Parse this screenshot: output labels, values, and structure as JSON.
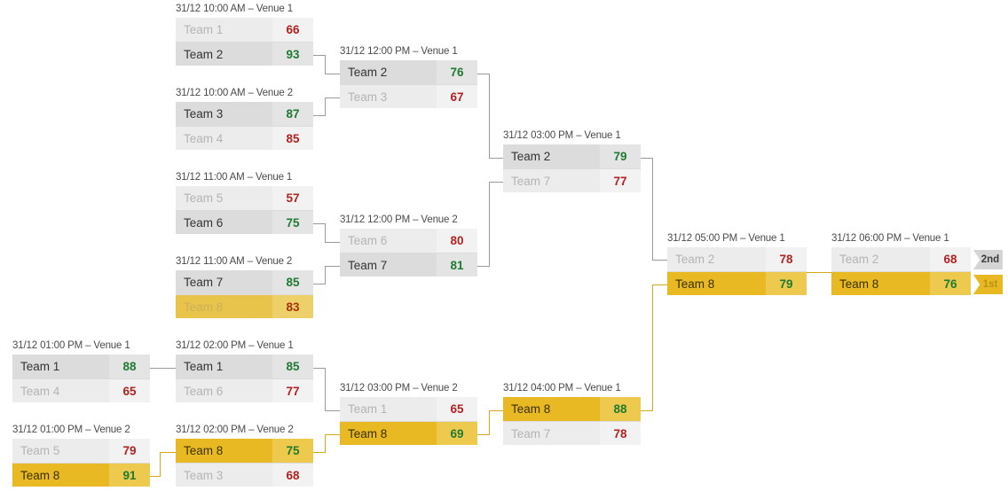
{
  "bracket": {
    "highlight_team": "Team 8",
    "colors": {
      "gold": "#e8b923",
      "gold_light": "#edca4e",
      "winner_bg": "#dcdcdc",
      "loser_bg": "#ececec",
      "win_score": "#1f7a32",
      "lose_score": "#b22222",
      "connector": "#9a9a9a",
      "connector_gold": "#d6a81e"
    },
    "badges": [
      {
        "key": "second",
        "label": "2nd"
      },
      {
        "key": "first",
        "label": "1st"
      }
    ],
    "matches": [
      {
        "id": "m1",
        "label": "31/12 10:00 AM – Venue 1",
        "top": {
          "name": "Team 1",
          "score": "66",
          "result": "lose",
          "gold": false
        },
        "bottom": {
          "name": "Team 2",
          "score": "93",
          "result": "win",
          "gold": false
        }
      },
      {
        "id": "m2",
        "label": "31/12 10:00 AM – Venue 2",
        "top": {
          "name": "Team 3",
          "score": "87",
          "result": "win",
          "gold": false
        },
        "bottom": {
          "name": "Team 4",
          "score": "85",
          "result": "lose",
          "gold": false
        }
      },
      {
        "id": "m3",
        "label": "31/12 11:00 AM – Venue 1",
        "top": {
          "name": "Team 5",
          "score": "57",
          "result": "lose",
          "gold": false
        },
        "bottom": {
          "name": "Team 6",
          "score": "75",
          "result": "win",
          "gold": false
        }
      },
      {
        "id": "m4",
        "label": "31/12 11:00 AM – Venue 2",
        "top": {
          "name": "Team 7",
          "score": "85",
          "result": "win",
          "gold": false
        },
        "bottom": {
          "name": "Team 8",
          "score": "83",
          "result": "lose",
          "gold": true
        }
      },
      {
        "id": "m5",
        "label": "31/12 12:00 PM – Venue 1",
        "top": {
          "name": "Team 2",
          "score": "76",
          "result": "win",
          "gold": false
        },
        "bottom": {
          "name": "Team 3",
          "score": "67",
          "result": "lose",
          "gold": false
        }
      },
      {
        "id": "m6",
        "label": "31/12 12:00 PM – Venue 2",
        "top": {
          "name": "Team 6",
          "score": "80",
          "result": "lose",
          "gold": false
        },
        "bottom": {
          "name": "Team 7",
          "score": "81",
          "result": "win",
          "gold": false
        }
      },
      {
        "id": "m7",
        "label": "31/12 03:00 PM – Venue 1",
        "top": {
          "name": "Team 2",
          "score": "79",
          "result": "win",
          "gold": false
        },
        "bottom": {
          "name": "Team 7",
          "score": "77",
          "result": "lose",
          "gold": false
        }
      },
      {
        "id": "m8",
        "label": "31/12 05:00 PM – Venue 1",
        "top": {
          "name": "Team 2",
          "score": "78",
          "result": "lose",
          "gold": false
        },
        "bottom": {
          "name": "Team 8",
          "score": "79",
          "result": "win",
          "gold": true
        }
      },
      {
        "id": "m9",
        "label": "31/12 06:00 PM – Venue 1",
        "top": {
          "name": "Team 2",
          "score": "68",
          "result": "lose",
          "gold": false
        },
        "bottom": {
          "name": "Team 8",
          "score": "76",
          "result": "win",
          "gold": true
        }
      },
      {
        "id": "m10",
        "label": "31/12 01:00 PM – Venue 1",
        "top": {
          "name": "Team 1",
          "score": "88",
          "result": "win",
          "gold": false
        },
        "bottom": {
          "name": "Team 4",
          "score": "65",
          "result": "lose",
          "gold": false
        }
      },
      {
        "id": "m11",
        "label": "31/12 01:00 PM – Venue 2",
        "top": {
          "name": "Team 5",
          "score": "79",
          "result": "lose",
          "gold": false
        },
        "bottom": {
          "name": "Team 8",
          "score": "91",
          "result": "win",
          "gold": true
        }
      },
      {
        "id": "m12",
        "label": "31/12 02:00 PM – Venue 1",
        "top": {
          "name": "Team 1",
          "score": "85",
          "result": "win",
          "gold": false
        },
        "bottom": {
          "name": "Team 6",
          "score": "77",
          "result": "lose",
          "gold": false
        }
      },
      {
        "id": "m13",
        "label": "31/12 02:00 PM – Venue 2",
        "top": {
          "name": "Team 8",
          "score": "75",
          "result": "win",
          "gold": true
        },
        "bottom": {
          "name": "Team 3",
          "score": "68",
          "result": "lose",
          "gold": false
        }
      },
      {
        "id": "m14",
        "label": "31/12 03:00 PM – Venue 2",
        "top": {
          "name": "Team 1",
          "score": "65",
          "result": "lose",
          "gold": false
        },
        "bottom": {
          "name": "Team 8",
          "score": "69",
          "result": "win",
          "gold": true
        }
      },
      {
        "id": "m15",
        "label": "31/12 04:00 PM – Venue 1",
        "top": {
          "name": "Team 8",
          "score": "88",
          "result": "win",
          "gold": true
        },
        "bottom": {
          "name": "Team 7",
          "score": "78",
          "result": "lose",
          "gold": false
        }
      }
    ]
  }
}
